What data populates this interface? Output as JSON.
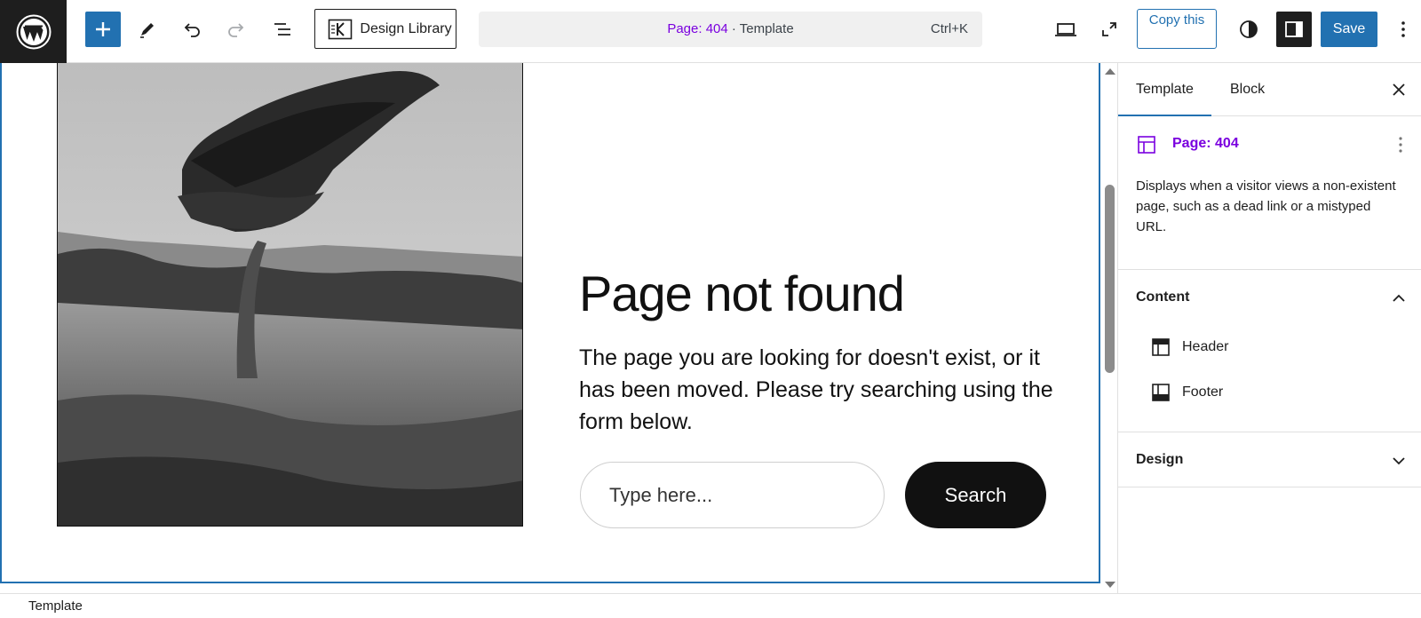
{
  "toolbar": {
    "design_library_label": "Design Library",
    "document_name": "Page: 404",
    "document_separator": " · ",
    "document_type": "Template",
    "shortcut": "Ctrl+K",
    "copy_label": "Copy this",
    "save_label": "Save",
    "icons": [
      "wordpress-logo",
      "plus-icon",
      "pencil-icon",
      "undo-icon",
      "redo-icon",
      "list-view-icon",
      "laptop-icon",
      "fullscreen-icon",
      "contrast-icon",
      "sidebar-icon",
      "more-vertical-icon"
    ]
  },
  "canvas": {
    "heading": "Page not found",
    "body": "The page you are looking for doesn't exist, or it has been moved. Please try searching using the form below.",
    "search_placeholder": "Type here...",
    "search_button": "Search"
  },
  "sidebar": {
    "tabs": [
      {
        "label": "Template",
        "active": true
      },
      {
        "label": "Block",
        "active": false
      }
    ],
    "template_name": "Page: 404",
    "template_description": "Displays when a visitor views a non-existent page, such as a dead link or a mistyped URL.",
    "content_panel": {
      "title": "Content",
      "expanded": true,
      "items": [
        {
          "label": "Header",
          "icon": "header-icon"
        },
        {
          "label": "Footer",
          "icon": "footer-icon"
        }
      ]
    },
    "design_panel": {
      "title": "Design",
      "expanded": false
    }
  },
  "footer": {
    "breadcrumb": "Template"
  },
  "colors": {
    "accent": "#2271b1",
    "template_purple": "#7a00df",
    "dark": "#1e1e1e"
  }
}
